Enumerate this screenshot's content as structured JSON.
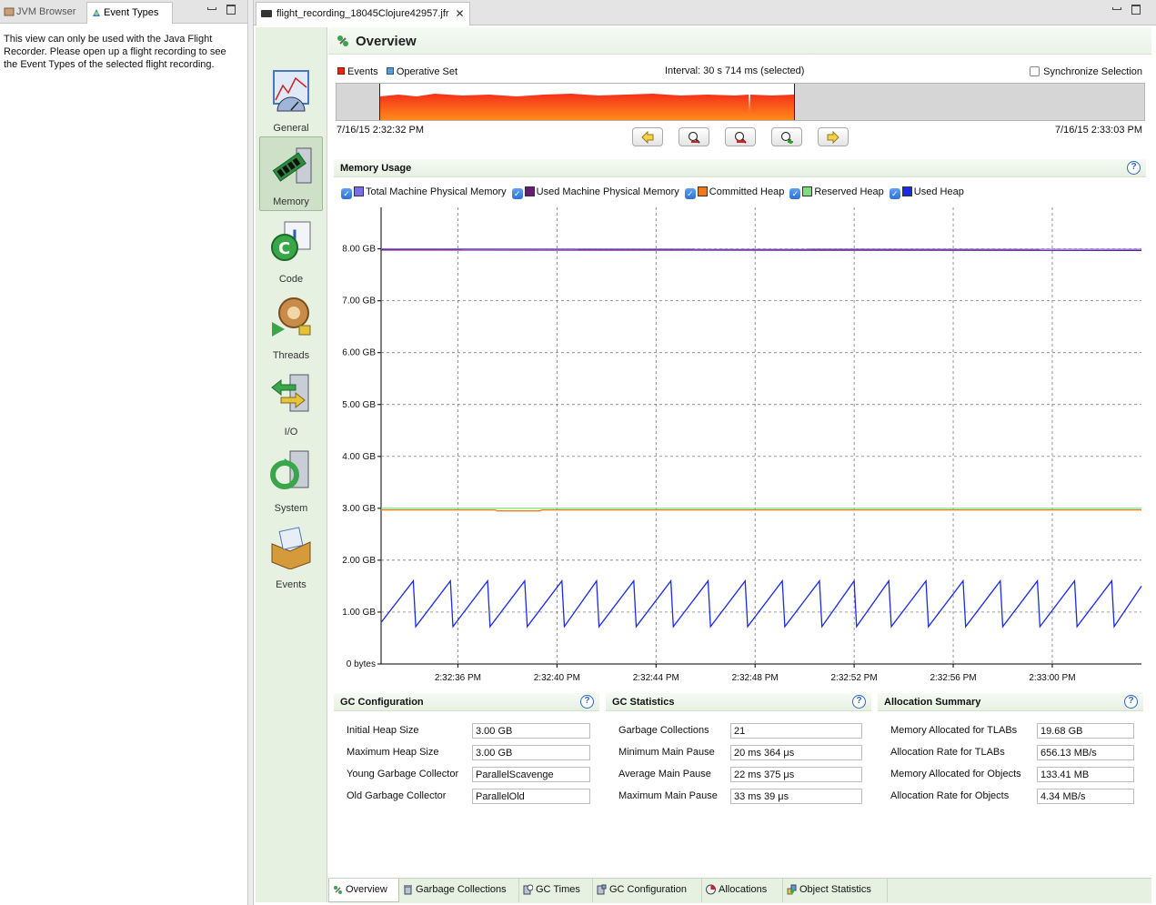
{
  "left_view": {
    "tabs": [
      {
        "label": "JVM Browser",
        "active": false
      },
      {
        "label": "Event Types",
        "active": true
      }
    ],
    "message": "This view can only be used with the Java Flight Recorder. Please open up a flight recording to see the Event Types of the selected flight recording."
  },
  "editor": {
    "tab_label": "flight_recording_18045Clojure42957.jfr"
  },
  "nav": {
    "items": [
      {
        "label": "General"
      },
      {
        "label": "Memory",
        "selected": true
      },
      {
        "label": "Code"
      },
      {
        "label": "Threads"
      },
      {
        "label": "I/O"
      },
      {
        "label": "System"
      },
      {
        "label": "Events"
      }
    ]
  },
  "overview": {
    "title": "Overview",
    "legend_events": "Events",
    "legend_operative": "Operative Set",
    "interval": "Interval: 30 s 714 ms (selected)",
    "sync_label": "Synchronize Selection",
    "time_start": "7/16/15 2:32:32 PM",
    "time_end": "7/16/15 2:33:03 PM",
    "colors": {
      "events": "#e8260f",
      "operative": "#5a9bd5"
    }
  },
  "memory_usage": {
    "title": "Memory Usage",
    "help": "?",
    "series_legend": [
      {
        "label": "Total Machine Physical Memory",
        "color": "#7b6bf0"
      },
      {
        "label": "Used Machine Physical Memory",
        "color": "#6b1a7a"
      },
      {
        "label": "Committed Heap",
        "color": "#f07a1a"
      },
      {
        "label": "Reserved Heap",
        "color": "#7ae07a"
      },
      {
        "label": "Used Heap",
        "color": "#1a2ae8"
      }
    ]
  },
  "chart_data": {
    "type": "line",
    "title": "Memory Usage",
    "y_tick_labels": [
      "0 bytes",
      "1.00 GB",
      "2.00 GB",
      "3.00 GB",
      "4.00 GB",
      "5.00 GB",
      "6.00 GB",
      "7.00 GB",
      "8.00 GB"
    ],
    "y_ticks_gb": [
      0,
      1,
      2,
      3,
      4,
      5,
      6,
      7,
      8
    ],
    "ylim_gb": [
      0,
      8.8
    ],
    "x_tick_labels": [
      "2:32:36 PM",
      "2:32:40 PM",
      "2:32:44 PM",
      "2:32:48 PM",
      "2:32:52 PM",
      "2:32:56 PM",
      "2:33:00 PM"
    ],
    "x_ticks_s": [
      36,
      40,
      44,
      48,
      52,
      56,
      60
    ],
    "xlim_s": [
      32.9,
      63.6
    ],
    "grid": true,
    "series": [
      {
        "name": "Total Machine Physical Memory",
        "color": "#7b6bf0",
        "x": [
          32.9,
          63.6
        ],
        "y": [
          8.0,
          7.99
        ]
      },
      {
        "name": "Used Machine Physical Memory",
        "color": "#6b1a7a",
        "x": [
          32.9,
          63.6
        ],
        "y": [
          7.98,
          7.97
        ]
      },
      {
        "name": "Reserved Heap",
        "color": "#7ae07a",
        "x": [
          32.9,
          63.6
        ],
        "y": [
          3.0,
          3.0
        ]
      },
      {
        "name": "Committed Heap",
        "color": "#f07a1a",
        "x": [
          32.9,
          37.5,
          37.6,
          39.3,
          39.4,
          63.6
        ],
        "y": [
          2.97,
          2.97,
          2.95,
          2.95,
          2.97,
          2.97
        ]
      },
      {
        "name": "Used Heap",
        "color": "#1a2ae8",
        "x": [
          32.9,
          34.2,
          34.3,
          35.7,
          35.8,
          37.2,
          37.3,
          38.7,
          38.8,
          40.2,
          40.3,
          41.6,
          41.7,
          43.1,
          43.2,
          44.6,
          44.7,
          46.1,
          46.2,
          47.6,
          47.7,
          49.1,
          49.2,
          50.6,
          50.7,
          52.0,
          52.1,
          53.4,
          53.5,
          54.9,
          55.0,
          56.4,
          56.5,
          57.9,
          58.0,
          59.4,
          59.5,
          60.9,
          61.0,
          62.4,
          62.5,
          63.6
        ],
        "y": [
          0.8,
          1.6,
          0.72,
          1.6,
          0.72,
          1.6,
          0.72,
          1.6,
          0.72,
          1.6,
          0.72,
          1.6,
          0.72,
          1.6,
          0.72,
          1.6,
          0.72,
          1.6,
          0.72,
          1.6,
          0.72,
          1.6,
          0.72,
          1.6,
          0.72,
          1.6,
          0.72,
          1.6,
          0.72,
          1.6,
          0.72,
          1.6,
          0.72,
          1.6,
          0.72,
          1.6,
          0.72,
          1.6,
          0.72,
          1.6,
          0.72,
          1.5
        ]
      }
    ]
  },
  "gc_configuration": {
    "title": "GC Configuration",
    "rows": [
      {
        "label": "Initial Heap Size",
        "value": "3.00 GB"
      },
      {
        "label": "Maximum Heap Size",
        "value": "3.00 GB"
      },
      {
        "label": "Young Garbage Collector",
        "value": "ParallelScavenge"
      },
      {
        "label": "Old Garbage Collector",
        "value": "ParallelOld"
      }
    ]
  },
  "gc_statistics": {
    "title": "GC Statistics",
    "rows": [
      {
        "label": "Garbage Collections",
        "value": "21"
      },
      {
        "label": "Minimum Main Pause",
        "value": "20 ms 364 μs"
      },
      {
        "label": "Average Main Pause",
        "value": "22 ms 375 μs"
      },
      {
        "label": "Maximum Main Pause",
        "value": "33 ms 39 μs"
      }
    ]
  },
  "allocation_summary": {
    "title": "Allocation Summary",
    "rows": [
      {
        "label": "Memory Allocated for TLABs",
        "value": "19.68 GB"
      },
      {
        "label": "Allocation Rate for TLABs",
        "value": "656.13 MB/s"
      },
      {
        "label": "Memory Allocated for Objects",
        "value": "133.41 MB"
      },
      {
        "label": "Allocation Rate for Objects",
        "value": "4.34 MB/s"
      }
    ]
  },
  "bottom_tabs": [
    {
      "label": "Overview",
      "active": true
    },
    {
      "label": "Garbage Collections"
    },
    {
      "label": "GC Times"
    },
    {
      "label": "GC Configuration"
    },
    {
      "label": "Allocations"
    },
    {
      "label": "Object Statistics"
    }
  ]
}
